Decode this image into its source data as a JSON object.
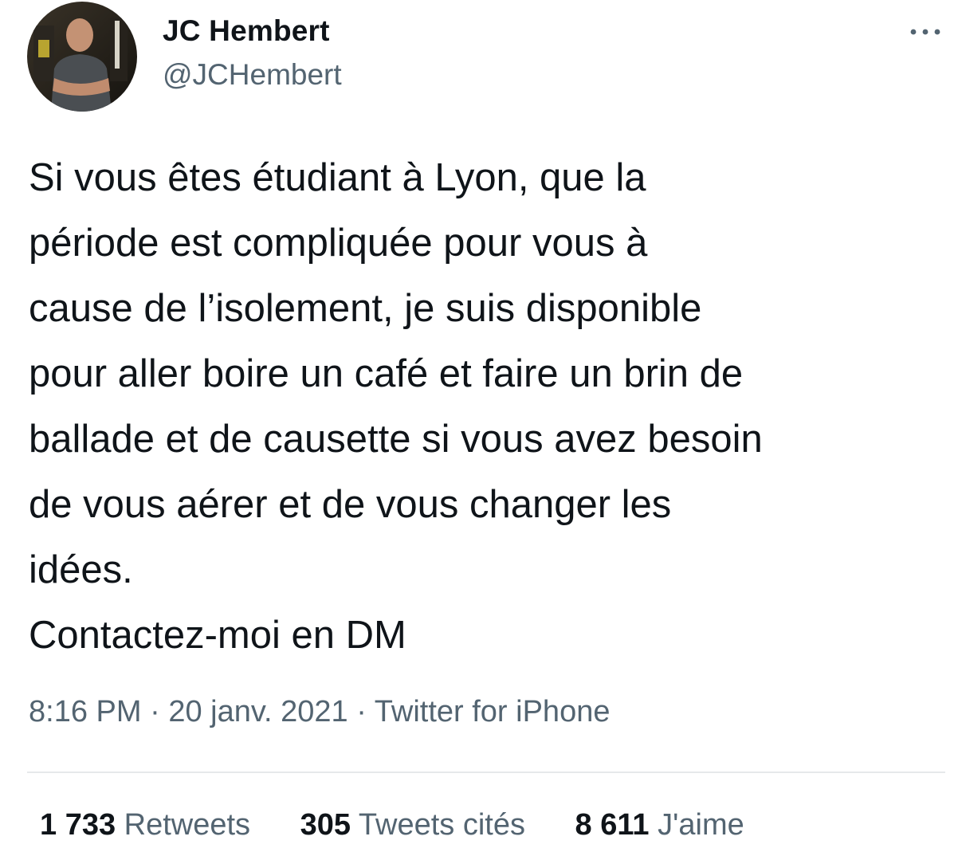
{
  "author": {
    "display_name": "JC Hembert",
    "handle": "@JCHembert",
    "avatar_icon": "profile-photo"
  },
  "menu": {
    "icon": "more-horizontal-icon",
    "glyph": "•••"
  },
  "tweet": {
    "text": "Si vous êtes étudiant à Lyon, que la\npériode est compliquée pour vous à\ncause de l’isolement, je suis disponible\npour aller boire un café et faire un brin de\nballade et de causette si vous avez besoin\nde vous aérer et de vous changer les\nidées.\nContactez-moi en DM"
  },
  "meta": {
    "time": "8:16 PM",
    "separator": " · ",
    "date": "20 janv. 2021",
    "source": "Twitter for iPhone"
  },
  "stats": {
    "retweets": {
      "count": "1 733",
      "label": "Retweets"
    },
    "quotes": {
      "count": "305",
      "label": "Tweets cités"
    },
    "likes": {
      "count": "8 611",
      "label": "J'aime"
    }
  },
  "colors": {
    "text_primary": "#0f1419",
    "text_secondary": "#536471",
    "divider": "#e6e9ea",
    "background": "#ffffff"
  }
}
